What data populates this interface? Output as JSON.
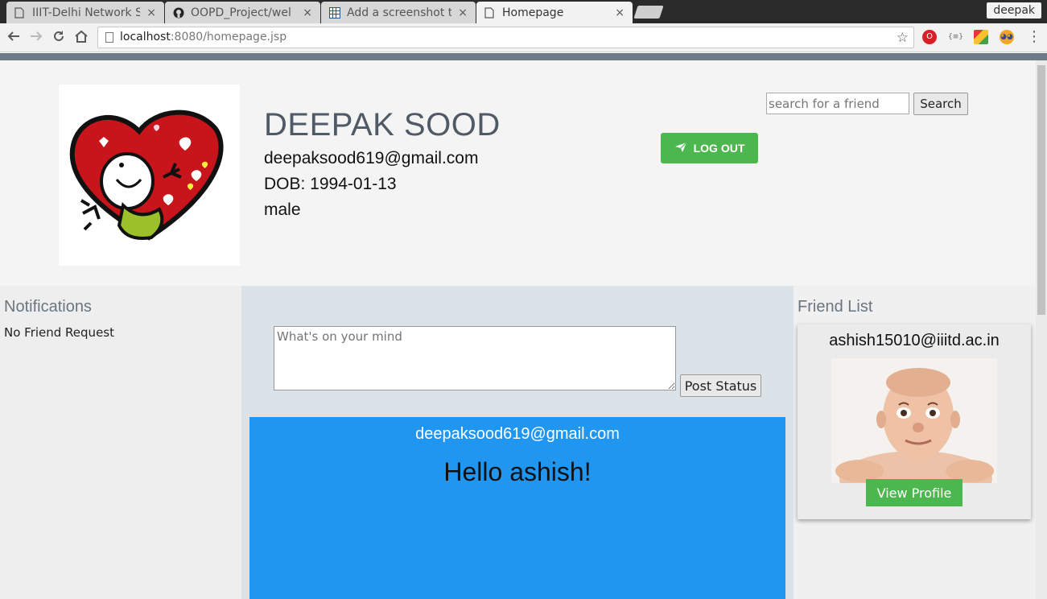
{
  "browser": {
    "tabs": [
      {
        "title": "IIIT-Delhi Network S",
        "icon": "page-icon"
      },
      {
        "title": "OOPD_Project/wel",
        "icon": "github-icon"
      },
      {
        "title": "Add a screenshot to",
        "icon": "grid-icon"
      },
      {
        "title": "Homepage",
        "icon": "page-icon"
      }
    ],
    "close_glyph": "×",
    "profile_name": "deepak",
    "url_host": "localhost",
    "url_path": ":8080/homepage.jsp",
    "colors": {
      "tabbar": "#2b2b2b",
      "toolbar": "#f2f2f2"
    }
  },
  "profile": {
    "name": "DEEPAK SOOD",
    "email": "deepaksood619@gmail.com",
    "dob": "DOB: 1994-01-13",
    "gender": "male",
    "avatar": "heart-avatar-image"
  },
  "header": {
    "logout_label": "LOG OUT",
    "search_placeholder": "search for a friend",
    "search_label": "Search"
  },
  "notifications": {
    "title": "Notifications",
    "text": "No Friend Request"
  },
  "status": {
    "placeholder": "What's on your mind",
    "post_label": "Post Status"
  },
  "post": {
    "author": "deepaksood619@gmail.com",
    "body": "Hello ashish!",
    "color": "#2196f0"
  },
  "friends": {
    "title": "Friend List",
    "items": [
      {
        "email": "ashish15010@iiitd.ac.in",
        "photo": "baby-photo",
        "button": "View Profile"
      }
    ]
  },
  "accent": "#4cb74f"
}
